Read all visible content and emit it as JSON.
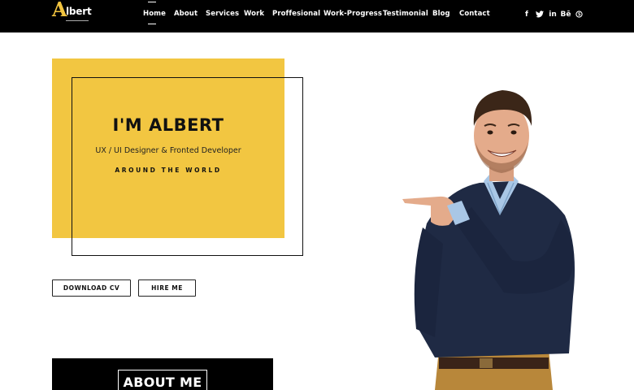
{
  "brand": {
    "logo_initial": "A",
    "logo_rest": "lbert",
    "accent_color": "#f2c641"
  },
  "nav": {
    "items": [
      {
        "label": "Home",
        "active": true
      },
      {
        "label": "About"
      },
      {
        "label": "Services"
      },
      {
        "label": "Work"
      },
      {
        "label": "Proffesional"
      },
      {
        "label": "Work-Progress"
      },
      {
        "label": "Testimonial"
      },
      {
        "label": "Blog"
      },
      {
        "label": "Contact"
      }
    ],
    "social": [
      {
        "icon": "facebook-icon",
        "glyph": "f"
      },
      {
        "icon": "twitter-icon",
        "glyph": "🐦"
      },
      {
        "icon": "linkedin-icon",
        "glyph": "in"
      },
      {
        "icon": "behance-icon",
        "glyph": "Bē"
      },
      {
        "icon": "skype-icon",
        "glyph": "S"
      }
    ]
  },
  "hero": {
    "title": "I'M ALBERT",
    "subtitle": "UX / UI Designer & Fronted Developer",
    "tagline": "AROUND THE WORLD",
    "download_button": "DOWNLOAD CV",
    "hire_button": "HIRE ME"
  },
  "about": {
    "heading": "ABOUT ME"
  }
}
